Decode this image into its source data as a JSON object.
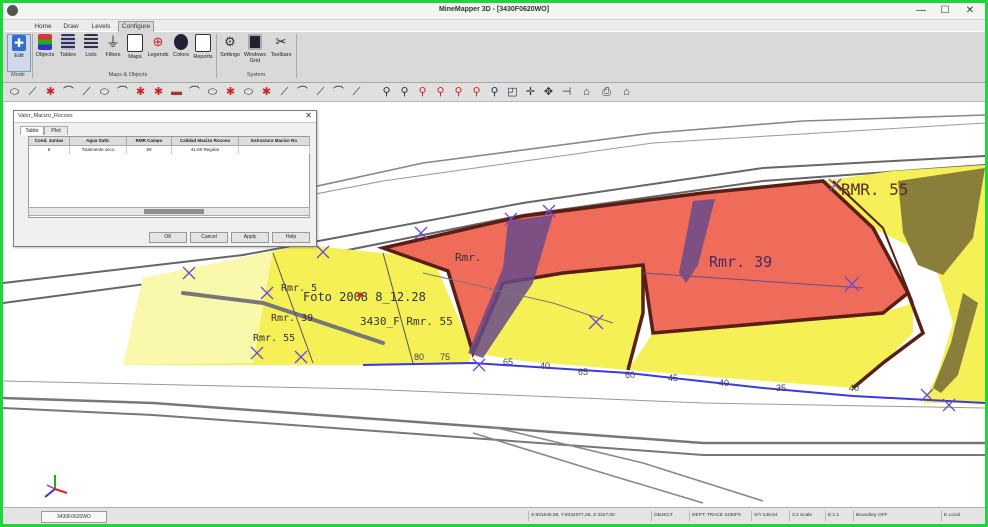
{
  "window": {
    "title": "MineMapper 3D - [3430F0620WO]",
    "minimize": "—",
    "maximize": "☐",
    "close": "✕"
  },
  "menu": {
    "tabs": [
      "Home",
      "Draw",
      "Levels",
      "Configure"
    ],
    "active_tab": "Configure"
  },
  "ribbon": {
    "buttons": [
      {
        "label": "Edit",
        "icon": "edit-icon"
      },
      {
        "label": "Objects",
        "icon": "objects-icon"
      },
      {
        "label": "Tables",
        "icon": "tables-icon"
      },
      {
        "label": "Lists",
        "icon": "lists-icon"
      },
      {
        "label": "Filters",
        "icon": "filter-icon"
      },
      {
        "label": "Maps",
        "icon": "maps-icon"
      },
      {
        "label": "Legends",
        "icon": "legends-icon"
      },
      {
        "label": "Colors",
        "icon": "colors-icon"
      },
      {
        "label": "Reports",
        "icon": "reports-icon"
      },
      {
        "label": "Settings",
        "icon": "settings-icon"
      },
      {
        "label": "Windows Grid",
        "icon": "windows-grid-icon"
      },
      {
        "label": "Toolbars",
        "icon": "toolbars-icon"
      }
    ],
    "groups": [
      "Mode",
      "Maps & Objects",
      "System"
    ],
    "accent": "#2f6fd0"
  },
  "dialog": {
    "title": "Valor_Macizo_Rocoso",
    "close": "✕",
    "tabs": [
      "Table",
      "Plot"
    ],
    "active_tab": "Table",
    "columns": [
      "Cond. Juntas",
      "Agua Subt.",
      "RMR Campo",
      "Calidad Macizo Rocoso",
      "Estructura Macizo Ro"
    ],
    "row": [
      "6",
      "Totalmente seco",
      "50",
      "41-60 Regular",
      ""
    ],
    "buttons": [
      "OK",
      "Cancel",
      "Apply",
      "Help"
    ]
  },
  "map": {
    "labels": {
      "rmr_55_top": "RMR. 55",
      "rmr_39_a": "Rmr.",
      "rmr_39_b": "Rmr. 39",
      "rmr_5": "Rmr. 5",
      "rmr_39_c": "Rmr. 39",
      "rmr_55_left": "Rmr. 55",
      "foto": "Foto 2008 8_12.28",
      "code": "3430_F  Rmr. 55"
    },
    "dip_values": [
      "80",
      "75",
      "65",
      "40",
      "65",
      "60",
      "45",
      "40",
      "35",
      "40"
    ],
    "colors": {
      "red_zone": "#ef6b5a",
      "yellow_zone": "#f5f056",
      "olive_zone": "#8a7f3a",
      "purple_zone": "#6a4a8a",
      "brown_line": "#5a1f14",
      "blue_line": "#3a3ae0"
    }
  },
  "status": {
    "doc_tab": "3430F0620WO",
    "cells": [
      "X:501845.08, Y:8432077.26, Z:3327.00",
      "OBJECT",
      "DEPT: TRACE 3430F0",
      "X/Y:148.64",
      "3:1 Scale",
      "E:1:1",
      "Boundary OFF",
      "E Local"
    ]
  }
}
